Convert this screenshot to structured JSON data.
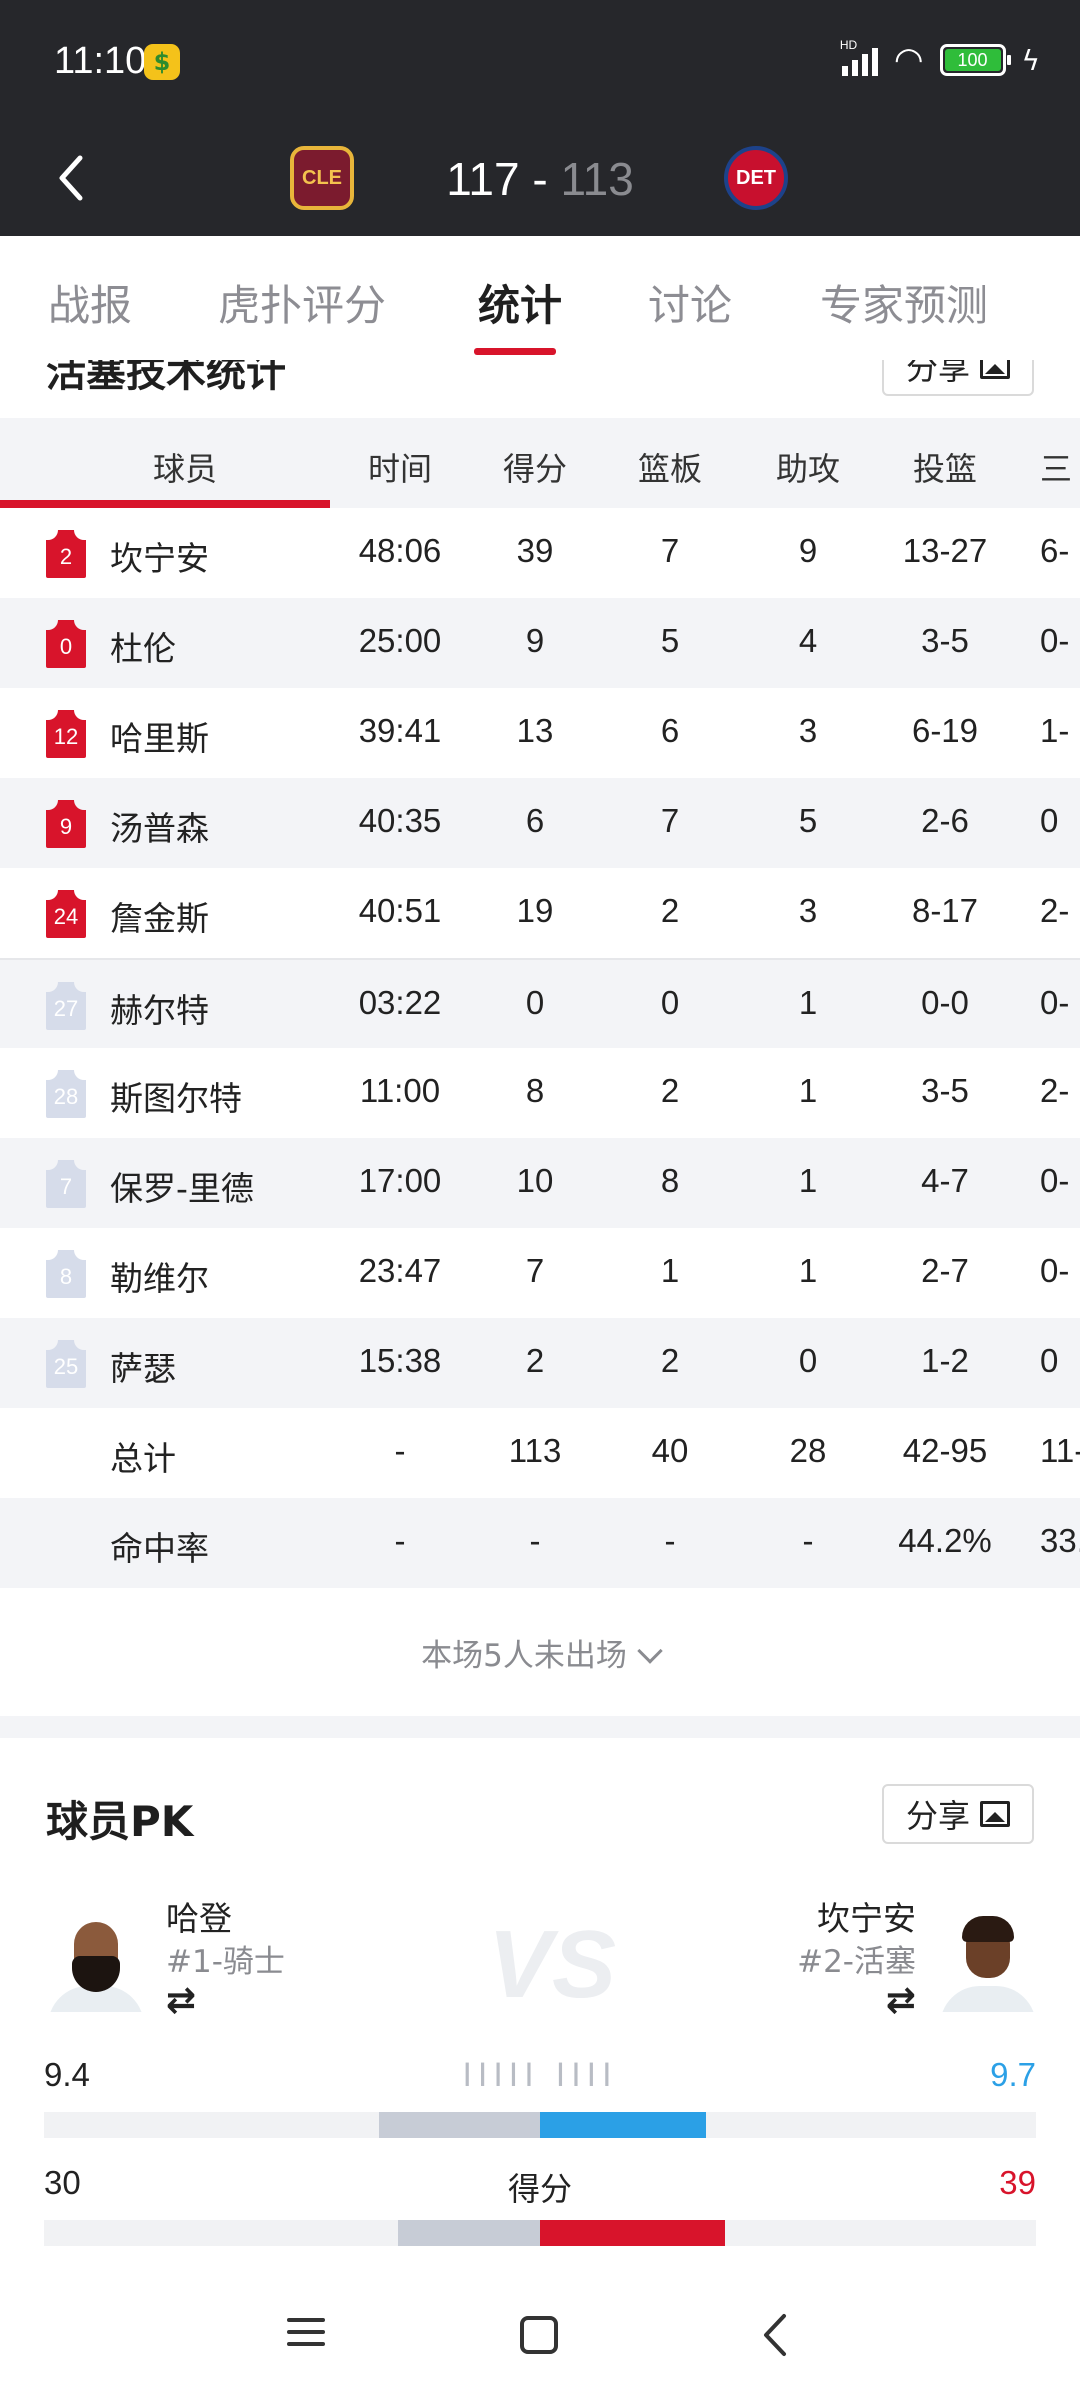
{
  "status_bar": {
    "time": "11:10",
    "network": "HD",
    "battery": "100"
  },
  "header": {
    "home_score": "117",
    "separator": "-",
    "away_score": "113",
    "home_team": "CLE",
    "away_team": "DET"
  },
  "tabs": [
    {
      "label": "战报",
      "active": false
    },
    {
      "label": "虎扑评分",
      "active": false
    },
    {
      "label": "统计",
      "active": true
    },
    {
      "label": "讨论",
      "active": false
    },
    {
      "label": "专家预测",
      "active": false
    }
  ],
  "stats_section": {
    "title": "活塞技术统计",
    "share_label": "分享",
    "columns": [
      "球员",
      "时间",
      "得分",
      "篮板",
      "助攻",
      "投篮",
      "三"
    ],
    "rows": [
      {
        "jersey": "2",
        "name": "坎宁安",
        "time": "48:06",
        "pts": "39",
        "reb": "7",
        "ast": "9",
        "fg": "13-27",
        "tp": "6-",
        "starter": true
      },
      {
        "jersey": "0",
        "name": "杜伦",
        "time": "25:00",
        "pts": "9",
        "reb": "5",
        "ast": "4",
        "fg": "3-5",
        "tp": "0-",
        "starter": true
      },
      {
        "jersey": "12",
        "name": "哈里斯",
        "time": "39:41",
        "pts": "13",
        "reb": "6",
        "ast": "3",
        "fg": "6-19",
        "tp": "1-",
        "starter": true
      },
      {
        "jersey": "9",
        "name": "汤普森",
        "time": "40:35",
        "pts": "6",
        "reb": "7",
        "ast": "5",
        "fg": "2-6",
        "tp": "0",
        "starter": true
      },
      {
        "jersey": "24",
        "name": "詹金斯",
        "time": "40:51",
        "pts": "19",
        "reb": "2",
        "ast": "3",
        "fg": "8-17",
        "tp": "2-",
        "starter": true
      },
      {
        "jersey": "27",
        "name": "赫尔特",
        "time": "03:22",
        "pts": "0",
        "reb": "0",
        "ast": "1",
        "fg": "0-0",
        "tp": "0-",
        "starter": false
      },
      {
        "jersey": "28",
        "name": "斯图尔特",
        "time": "11:00",
        "pts": "8",
        "reb": "2",
        "ast": "1",
        "fg": "3-5",
        "tp": "2-",
        "starter": false
      },
      {
        "jersey": "7",
        "name": "保罗-里德",
        "time": "17:00",
        "pts": "10",
        "reb": "8",
        "ast": "1",
        "fg": "4-7",
        "tp": "0-",
        "starter": false
      },
      {
        "jersey": "8",
        "name": "勒维尔",
        "time": "23:47",
        "pts": "7",
        "reb": "1",
        "ast": "1",
        "fg": "2-7",
        "tp": "0-",
        "starter": false
      },
      {
        "jersey": "25",
        "name": "萨瑟",
        "time": "15:38",
        "pts": "2",
        "reb": "2",
        "ast": "0",
        "fg": "1-2",
        "tp": "0",
        "starter": false
      }
    ],
    "totals": {
      "name": "总计",
      "time": "-",
      "pts": "113",
      "reb": "40",
      "ast": "28",
      "fg": "42-95",
      "tp": "11-"
    },
    "pct": {
      "name": "命中率",
      "time": "-",
      "pts": "-",
      "reb": "-",
      "ast": "-",
      "fg": "44.2%",
      "tp": "33."
    },
    "dnp_label": "本场5人未出场"
  },
  "player_pk": {
    "title": "球员PK",
    "share_label": "分享",
    "left": {
      "name": "哈登",
      "sub": "#1-骑士"
    },
    "right": {
      "name": "坎宁安",
      "sub": "#2-活塞"
    },
    "vs": "VS",
    "swap_icon": "⇄",
    "compare": [
      {
        "label": "IIIII IIII",
        "left": "9.4",
        "right": "9.7",
        "left_share": 0.492,
        "right_share": 0.508,
        "color": "#2ba0e6"
      },
      {
        "label": "得分",
        "left": "30",
        "right": "39",
        "left_share": 0.435,
        "right_share": 0.565,
        "color": "#d8142b"
      }
    ]
  },
  "colors": {
    "accent": "#d8142b",
    "header_bg": "#26272b",
    "blue": "#2ba0e6"
  }
}
